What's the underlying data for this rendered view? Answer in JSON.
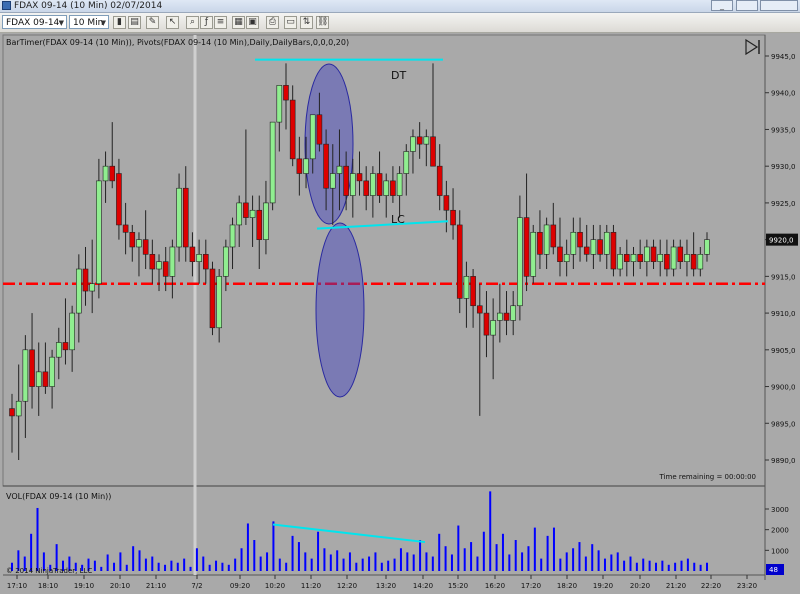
{
  "window": {
    "title": "FDAX 09-14 (10 Min)  02/07/2014",
    "minimize_label": "_",
    "maximize_label": "",
    "close_label": ""
  },
  "toolbar": {
    "instrument": "FDAX 09-14",
    "interval": "10 Min",
    "icons": [
      "bar-type-icon",
      "chart-style-icon",
      "draw-tool-icon",
      "cursor-icon",
      "zoom-icon",
      "indicators-icon",
      "strategies-icon",
      "properties-icon",
      "data-box-icon",
      "print-icon",
      "screenshot-icon",
      "chart-trader-icon",
      "link-icon"
    ]
  },
  "indicator_label": "BarTimer(FDAX 09-14 (10 Min)), Pivots(FDAX 09-14 (10 Min),Daily,DailyBars,0,0,0,20)",
  "annotations": {
    "dt": "DT",
    "lc": "LC"
  },
  "time_remaining": "Time remaining = 00:00:00",
  "volume_label": "VOL(FDAX 09-14 (10 Min))",
  "copyright": "© 2014 NinjaTrader, LLC",
  "colors": {
    "background": "#a9a9a9",
    "up_candle": "#90ee90",
    "down_candle": "#dd0000",
    "pivot_line": "#ff0000",
    "trendline": "#00e5ee",
    "ellipse": "#4040c0",
    "volume_bar": "#0000ff"
  },
  "chart_data": [
    {
      "type": "candlestick",
      "title": "FDAX 09-14 (10 Min)",
      "ylim": [
        9885,
        9947
      ],
      "y_ticks": [
        "9945,0",
        "9940,0",
        "9935,0",
        "9930,0",
        "9925,0",
        "9920,0",
        "9915,0",
        "9910,0",
        "9905,0",
        "9900,0",
        "9895,0",
        "9890,0"
      ],
      "x_ticks": [
        "17:10",
        "18:10",
        "19:10",
        "20:10",
        "21:10",
        "7/2",
        "09:20",
        "10:20",
        "11:20",
        "12:20",
        "13:20",
        "14:20",
        "15:20",
        "16:20",
        "17:20",
        "18:20",
        "19:20",
        "20:20",
        "21:20",
        "22:20",
        "23:20"
      ],
      "last_price": "9920,0",
      "pivot_level": 9914,
      "candles": [
        {
          "o": 9897,
          "h": 9899,
          "l": 9891,
          "c": 9896
        },
        {
          "o": 9896,
          "h": 9903,
          "l": 9890,
          "c": 9898
        },
        {
          "o": 9898,
          "h": 9907,
          "l": 9893,
          "c": 9905
        },
        {
          "o": 9905,
          "h": 9910,
          "l": 9897,
          "c": 9900
        },
        {
          "o": 9900,
          "h": 9906,
          "l": 9896,
          "c": 9902
        },
        {
          "o": 9902,
          "h": 9906,
          "l": 9899,
          "c": 9900
        },
        {
          "o": 9900,
          "h": 9905,
          "l": 9897,
          "c": 9904
        },
        {
          "o": 9904,
          "h": 9908,
          "l": 9901,
          "c": 9906
        },
        {
          "o": 9906,
          "h": 9912,
          "l": 9903,
          "c": 9905
        },
        {
          "o": 9905,
          "h": 9911,
          "l": 9902,
          "c": 9910
        },
        {
          "o": 9910,
          "h": 9918,
          "l": 9906,
          "c": 9916
        },
        {
          "o": 9916,
          "h": 9919,
          "l": 9911,
          "c": 9913
        },
        {
          "o": 9913,
          "h": 9920,
          "l": 9910,
          "c": 9914
        },
        {
          "o": 9914,
          "h": 9931,
          "l": 9912,
          "c": 9928
        },
        {
          "o": 9928,
          "h": 9932,
          "l": 9925,
          "c": 9930
        },
        {
          "o": 9930,
          "h": 9936,
          "l": 9927,
          "c": 9928
        },
        {
          "o": 9929,
          "h": 9931,
          "l": 9920,
          "c": 9922
        },
        {
          "o": 9922,
          "h": 9925,
          "l": 9918,
          "c": 9921
        },
        {
          "o": 9921,
          "h": 9922,
          "l": 9917,
          "c": 9919
        },
        {
          "o": 9919,
          "h": 9921,
          "l": 9915,
          "c": 9920
        },
        {
          "o": 9920,
          "h": 9924,
          "l": 9916,
          "c": 9918
        },
        {
          "o": 9918,
          "h": 9920,
          "l": 9914,
          "c": 9916
        },
        {
          "o": 9916,
          "h": 9918,
          "l": 9913,
          "c": 9917
        },
        {
          "o": 9917,
          "h": 9919,
          "l": 9913,
          "c": 9915
        },
        {
          "o": 9915,
          "h": 9920,
          "l": 9912,
          "c": 9919
        },
        {
          "o": 9919,
          "h": 9929,
          "l": 9917,
          "c": 9927
        },
        {
          "o": 9927,
          "h": 9930,
          "l": 9917,
          "c": 9919
        },
        {
          "o": 9919,
          "h": 9921,
          "l": 9915,
          "c": 9917
        },
        {
          "o": 9917,
          "h": 9920,
          "l": 9914,
          "c": 9918
        },
        {
          "o": 9918,
          "h": 9920,
          "l": 9914,
          "c": 9916
        },
        {
          "o": 9916,
          "h": 9917,
          "l": 9907,
          "c": 9908
        },
        {
          "o": 9908,
          "h": 9916,
          "l": 9906,
          "c": 9915
        },
        {
          "o": 9915,
          "h": 9920,
          "l": 9913,
          "c": 9919
        },
        {
          "o": 9919,
          "h": 9923,
          "l": 9916,
          "c": 9922
        },
        {
          "o": 9922,
          "h": 9926,
          "l": 9919,
          "c": 9925
        },
        {
          "o": 9925,
          "h": 9935,
          "l": 9922,
          "c": 9923
        },
        {
          "o": 9923,
          "h": 9926,
          "l": 9919,
          "c": 9924
        },
        {
          "o": 9924,
          "h": 9926,
          "l": 9916,
          "c": 9920
        },
        {
          "o": 9920,
          "h": 9928,
          "l": 9918,
          "c": 9925
        },
        {
          "o": 9925,
          "h": 9933,
          "l": 9924,
          "c": 9936
        },
        {
          "o": 9936,
          "h": 9940,
          "l": 9932,
          "c": 9941
        },
        {
          "o": 9941,
          "h": 9944,
          "l": 9935,
          "c": 9939
        },
        {
          "o": 9939,
          "h": 9941,
          "l": 9930,
          "c": 9931
        },
        {
          "o": 9931,
          "h": 9934,
          "l": 9926,
          "c": 9929
        },
        {
          "o": 9929,
          "h": 9934,
          "l": 9927,
          "c": 9931
        },
        {
          "o": 9931,
          "h": 9937,
          "l": 9929,
          "c": 9937
        },
        {
          "o": 9937,
          "h": 9940,
          "l": 9932,
          "c": 9933
        },
        {
          "o": 9933,
          "h": 9935,
          "l": 9924,
          "c": 9927
        },
        {
          "o": 9927,
          "h": 9933,
          "l": 9922,
          "c": 9929
        },
        {
          "o": 9929,
          "h": 9935,
          "l": 9924,
          "c": 9930
        },
        {
          "o": 9930,
          "h": 9932,
          "l": 9924,
          "c": 9926
        },
        {
          "o": 9926,
          "h": 9931,
          "l": 9923,
          "c": 9929
        },
        {
          "o": 9929,
          "h": 9932,
          "l": 9926,
          "c": 9928
        },
        {
          "o": 9928,
          "h": 9930,
          "l": 9924,
          "c": 9926
        },
        {
          "o": 9926,
          "h": 9930,
          "l": 9923,
          "c": 9929
        },
        {
          "o": 9929,
          "h": 9932,
          "l": 9925,
          "c": 9926
        },
        {
          "o": 9926,
          "h": 9929,
          "l": 9923,
          "c": 9928
        },
        {
          "o": 9928,
          "h": 9930,
          "l": 9925,
          "c": 9926
        },
        {
          "o": 9926,
          "h": 9930,
          "l": 9923,
          "c": 9929
        },
        {
          "o": 9929,
          "h": 9933,
          "l": 9926,
          "c": 9932
        },
        {
          "o": 9932,
          "h": 9935,
          "l": 9929,
          "c": 9934
        },
        {
          "o": 9934,
          "h": 9936,
          "l": 9931,
          "c": 9933
        },
        {
          "o": 9933,
          "h": 9935,
          "l": 9930,
          "c": 9934
        },
        {
          "o": 9934,
          "h": 9944,
          "l": 9931,
          "c": 9930
        },
        {
          "o": 9930,
          "h": 9933,
          "l": 9924,
          "c": 9926
        },
        {
          "o": 9926,
          "h": 9928,
          "l": 9921,
          "c": 9924
        },
        {
          "o": 9924,
          "h": 9927,
          "l": 9920,
          "c": 9922
        },
        {
          "o": 9922,
          "h": 9924,
          "l": 9910,
          "c": 9912
        },
        {
          "o": 9912,
          "h": 9917,
          "l": 9908,
          "c": 9915
        },
        {
          "o": 9915,
          "h": 9916,
          "l": 9908,
          "c": 9911
        },
        {
          "o": 9911,
          "h": 9914,
          "l": 9896,
          "c": 9910
        },
        {
          "o": 9910,
          "h": 9913,
          "l": 9904,
          "c": 9907
        },
        {
          "o": 9907,
          "h": 9912,
          "l": 9901,
          "c": 9909
        },
        {
          "o": 9909,
          "h": 9914,
          "l": 9906,
          "c": 9910
        },
        {
          "o": 9910,
          "h": 9913,
          "l": 9907,
          "c": 9909
        },
        {
          "o": 9909,
          "h": 9913,
          "l": 9907,
          "c": 9911
        },
        {
          "o": 9911,
          "h": 9926,
          "l": 9909,
          "c": 9923
        },
        {
          "o": 9923,
          "h": 9929,
          "l": 9913,
          "c": 9915
        },
        {
          "o": 9915,
          "h": 9922,
          "l": 9914,
          "c": 9921
        },
        {
          "o": 9921,
          "h": 9924,
          "l": 9916,
          "c": 9918
        },
        {
          "o": 9918,
          "h": 9923,
          "l": 9916,
          "c": 9922
        },
        {
          "o": 9922,
          "h": 9925,
          "l": 9918,
          "c": 9919
        },
        {
          "o": 9919,
          "h": 9923,
          "l": 9915,
          "c": 9917
        },
        {
          "o": 9917,
          "h": 9920,
          "l": 9915,
          "c": 9918
        },
        {
          "o": 9918,
          "h": 9923,
          "l": 9916,
          "c": 9921
        },
        {
          "o": 9921,
          "h": 9923,
          "l": 9917,
          "c": 9919
        },
        {
          "o": 9919,
          "h": 9922,
          "l": 9917,
          "c": 9918
        },
        {
          "o": 9918,
          "h": 9922,
          "l": 9916,
          "c": 9920
        },
        {
          "o": 9920,
          "h": 9922,
          "l": 9917,
          "c": 9918
        },
        {
          "o": 9918,
          "h": 9922,
          "l": 9916,
          "c": 9921
        },
        {
          "o": 9921,
          "h": 9922,
          "l": 9915,
          "c": 9916
        },
        {
          "o": 9916,
          "h": 9919,
          "l": 9915,
          "c": 9918
        },
        {
          "o": 9918,
          "h": 9920,
          "l": 9915,
          "c": 9917
        },
        {
          "o": 9917,
          "h": 9919,
          "l": 9915,
          "c": 9918
        },
        {
          "o": 9918,
          "h": 9920,
          "l": 9916,
          "c": 9917
        },
        {
          "o": 9917,
          "h": 9920,
          "l": 9915,
          "c": 9919
        },
        {
          "o": 9919,
          "h": 9920,
          "l": 9916,
          "c": 9917
        },
        {
          "o": 9917,
          "h": 9920,
          "l": 9915,
          "c": 9918
        },
        {
          "o": 9918,
          "h": 9920,
          "l": 9915,
          "c": 9916
        },
        {
          "o": 9916,
          "h": 9920,
          "l": 9915,
          "c": 9919
        },
        {
          "o": 9919,
          "h": 9920,
          "l": 9916,
          "c": 9917
        },
        {
          "o": 9917,
          "h": 9920,
          "l": 9915,
          "c": 9918
        },
        {
          "o": 9918,
          "h": 9921,
          "l": 9915,
          "c": 9916
        },
        {
          "o": 9916,
          "h": 9919,
          "l": 9915,
          "c": 9918
        },
        {
          "o": 9918,
          "h": 9921,
          "l": 9917,
          "c": 9920
        }
      ]
    },
    {
      "type": "bar",
      "title": "VOL(FDAX 09-14 (10 Min))",
      "ylim": [
        0,
        4600
      ],
      "y_ticks": [
        "3000",
        "2000",
        "1000"
      ],
      "last_value": "48",
      "values": [
        400,
        1000,
        700,
        1800,
        3050,
        900,
        300,
        1300,
        500,
        700,
        400,
        300,
        600,
        500,
        200,
        800,
        400,
        900,
        300,
        1200,
        1000,
        600,
        700,
        400,
        300,
        500,
        400,
        600,
        200,
        1100,
        700,
        300,
        500,
        400,
        300,
        600,
        1100,
        2300,
        1500,
        700,
        900,
        2400,
        600,
        400,
        1700,
        1400,
        900,
        600,
        1900,
        1100,
        800,
        1000,
        600,
        900,
        400,
        600,
        700,
        900,
        400,
        500,
        600,
        1100,
        900,
        800,
        1500,
        900,
        700,
        1800,
        1200,
        800,
        2200,
        1100,
        1400,
        700,
        1900,
        3850,
        1300,
        1800,
        800,
        1500,
        900,
        1200,
        2100,
        600,
        1700,
        2100,
        600,
        900,
        1100,
        1400,
        700,
        1300,
        1000,
        600,
        800,
        900,
        500,
        700,
        400,
        600,
        500,
        400,
        500,
        300,
        400,
        500,
        600,
        400,
        300,
        400
      ]
    }
  ]
}
